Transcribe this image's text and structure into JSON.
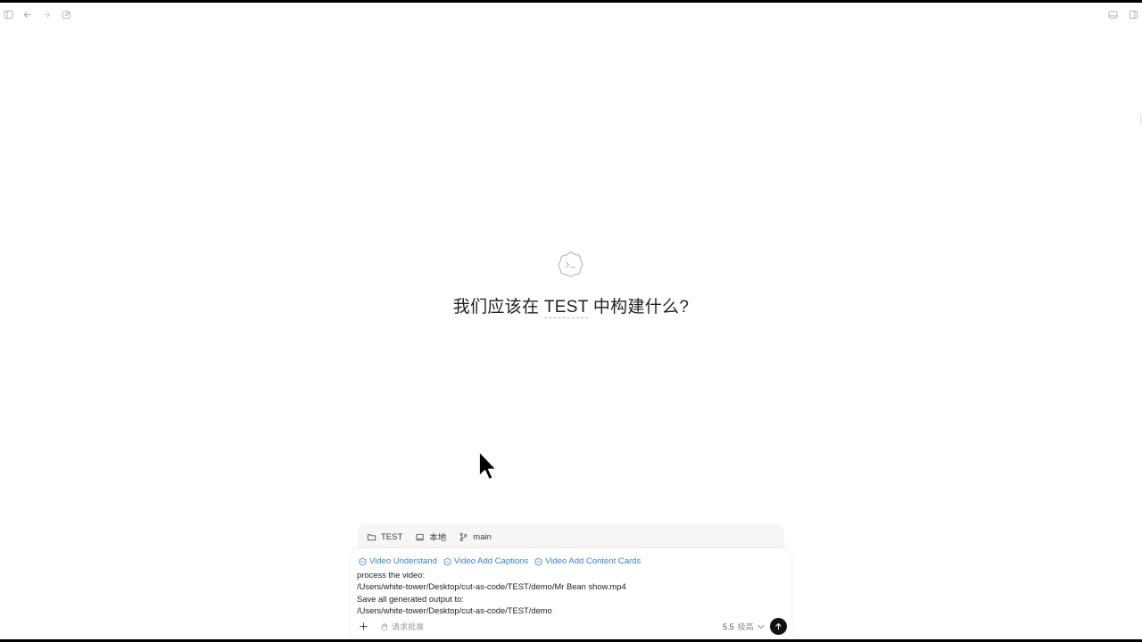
{
  "toolbar": {
    "icons": [
      "sidebar-icon",
      "back-arrow-icon",
      "forward-arrow-icon",
      "new-chat-icon",
      "panel-icon",
      "layout-icon"
    ]
  },
  "hero": {
    "icon": "codex-terminal-icon",
    "title_prefix": "我们应该在 ",
    "project": "TEST",
    "title_suffix": " 中构建什么?"
  },
  "context": {
    "folder": "TEST",
    "environment": "本地",
    "branch": "main"
  },
  "composer": {
    "skills": [
      "Video Understand",
      "Video Add Captions",
      "Video Add Content Cards"
    ],
    "prompt_lines": [
      "process the video:",
      "/Users/white-tower/Desktop/cut-as-code/TEST/demo/Mr Bean show.mp4",
      "Save all generated output to:",
      "/Users/white-tower/Desktop/cut-as-code/TEST/demo"
    ],
    "approval_label": "请求批准",
    "model": "5.5",
    "effort": "极高"
  },
  "colors": {
    "skill_link": "#3a7fc9",
    "send_button": "#111111",
    "context_bar_bg": "#f6f6f6"
  }
}
